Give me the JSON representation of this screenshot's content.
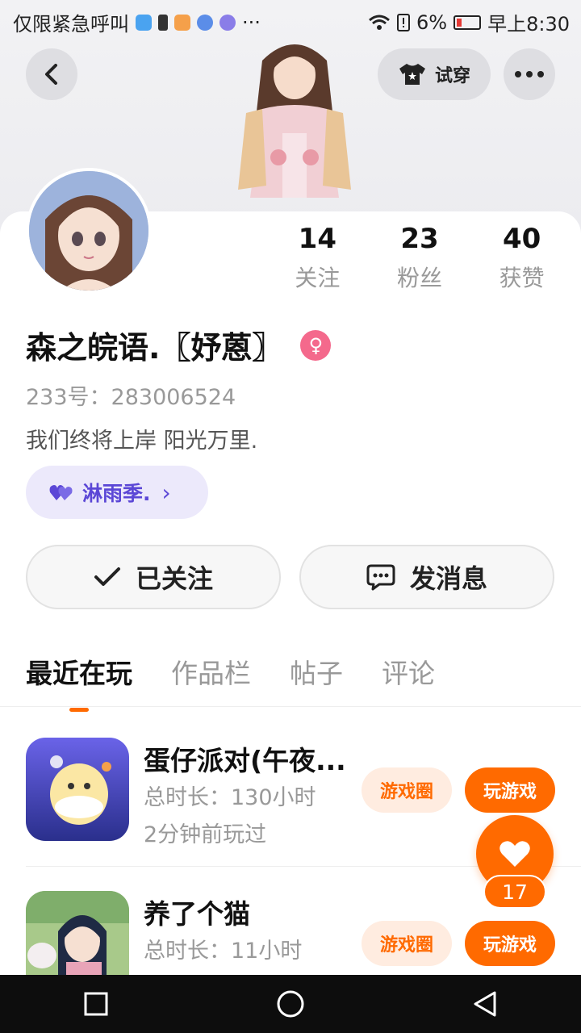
{
  "status_bar": {
    "left_text": "仅限紧急呼叫",
    "more": "···",
    "battery_percent": "6%",
    "time": "早上8:30"
  },
  "header": {
    "try_on_label": "试穿"
  },
  "profile": {
    "stats": [
      {
        "value": "14",
        "label": "关注"
      },
      {
        "value": "23",
        "label": "粉丝"
      },
      {
        "value": "40",
        "label": "获赞"
      }
    ],
    "name": "森之皖语.〖妤蒽〗",
    "gender_symbol": "♀",
    "uid": "233号：283006524",
    "bio": "我们终将上岸 阳光万里.",
    "tag": "淋雨季.",
    "tag_arrow": "›"
  },
  "actions": {
    "followed_label": "已关注",
    "message_label": "发消息"
  },
  "tabs": [
    "最近在玩",
    "作品栏",
    "帖子",
    "评论"
  ],
  "games": [
    {
      "name": "蛋仔派对(午夜...",
      "duration": "总时长：130小时",
      "last_played": "2分钟前玩过",
      "circle_label": "游戏圈",
      "play_label": "玩游戏"
    },
    {
      "name": "养了个猫",
      "duration": "总时长：11小时",
      "last_played": "",
      "circle_label": "游戏圈",
      "play_label": "玩游戏"
    }
  ],
  "like": {
    "count": "17"
  },
  "colors": {
    "accent": "#ff6a00",
    "tag_bg": "#ece9fb",
    "tag_text": "#5b47d6",
    "gender": "#f4698c"
  }
}
